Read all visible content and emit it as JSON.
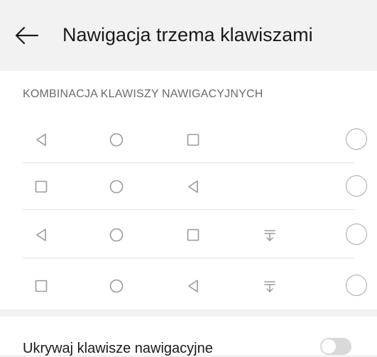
{
  "header": {
    "title": "Nawigacja trzema klawiszami",
    "back_icon": "arrow-left-icon"
  },
  "section": {
    "title": "KOMBINACJA KLAWISZY NAWIGACYJNYCH"
  },
  "combinations": [
    {
      "keys": [
        "back-icon",
        "home-icon",
        "recents-icon"
      ],
      "selected": false
    },
    {
      "keys": [
        "recents-icon",
        "home-icon",
        "back-icon"
      ],
      "selected": false
    },
    {
      "keys": [
        "back-icon",
        "home-icon",
        "recents-icon",
        "notification-pulldown-icon"
      ],
      "selected": false
    },
    {
      "keys": [
        "recents-icon",
        "home-icon",
        "back-icon",
        "notification-pulldown-icon"
      ],
      "selected": false
    }
  ],
  "setting": {
    "label": "Ukrywaj klawisze nawigacyjne",
    "enabled": false
  },
  "colors": {
    "background": "#f2f2f2",
    "card": "#ffffff",
    "icon": "#9a9a9a",
    "divider": "#e4e4e4"
  }
}
